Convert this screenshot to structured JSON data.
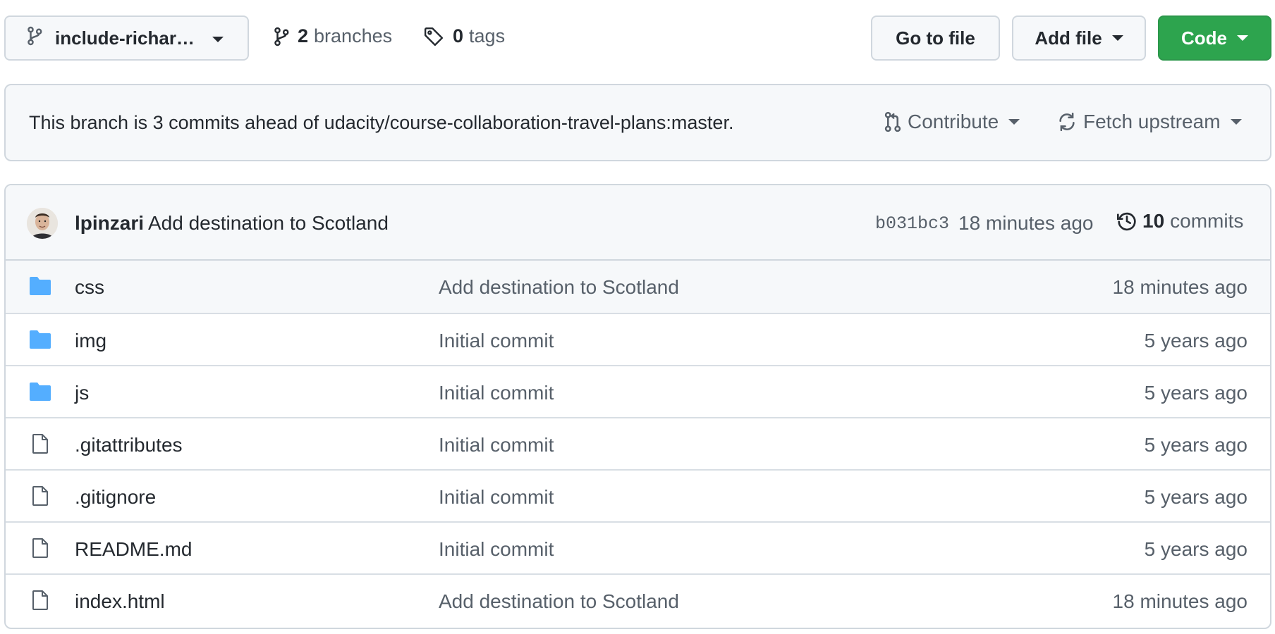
{
  "toolbar": {
    "branch_name": "include-richar…",
    "branches_count": "2",
    "branches_label": "branches",
    "tags_count": "0",
    "tags_label": "tags",
    "go_to_file_label": "Go to file",
    "add_file_label": "Add file",
    "code_label": "Code"
  },
  "ahead": {
    "message": "This branch is 3 commits ahead of udacity/course-collaboration-travel-plans:master.",
    "contribute_label": "Contribute",
    "fetch_label": "Fetch upstream"
  },
  "latest_commit": {
    "author": "lpinzari",
    "message": "Add destination to Scotland",
    "sha": "b031bc3",
    "time": "18 minutes ago",
    "commit_count": "10",
    "commit_count_label": "commits"
  },
  "files": [
    {
      "name": "css",
      "type": "folder",
      "commit": "Add destination to Scotland",
      "time": "18 minutes ago"
    },
    {
      "name": "img",
      "type": "folder",
      "commit": "Initial commit",
      "time": "5 years ago"
    },
    {
      "name": "js",
      "type": "folder",
      "commit": "Initial commit",
      "time": "5 years ago"
    },
    {
      "name": ".gitattributes",
      "type": "file",
      "commit": "Initial commit",
      "time": "5 years ago"
    },
    {
      "name": ".gitignore",
      "type": "file",
      "commit": "Initial commit",
      "time": "5 years ago"
    },
    {
      "name": "README.md",
      "type": "file",
      "commit": "Initial commit",
      "time": "5 years ago"
    },
    {
      "name": "index.html",
      "type": "file",
      "commit": "Add destination to Scotland",
      "time": "18 minutes ago"
    }
  ],
  "colors": {
    "primary_button": "#2da44e",
    "folder_icon": "#54aeff",
    "muted_text": "#57606a",
    "border": "#d0d7de"
  },
  "icons": {
    "branch": "git-branch-icon",
    "tag": "tag-icon",
    "contribute": "git-pull-request-icon",
    "fetch": "sync-icon",
    "history": "history-icon",
    "folder": "folder-icon",
    "file": "file-icon"
  }
}
